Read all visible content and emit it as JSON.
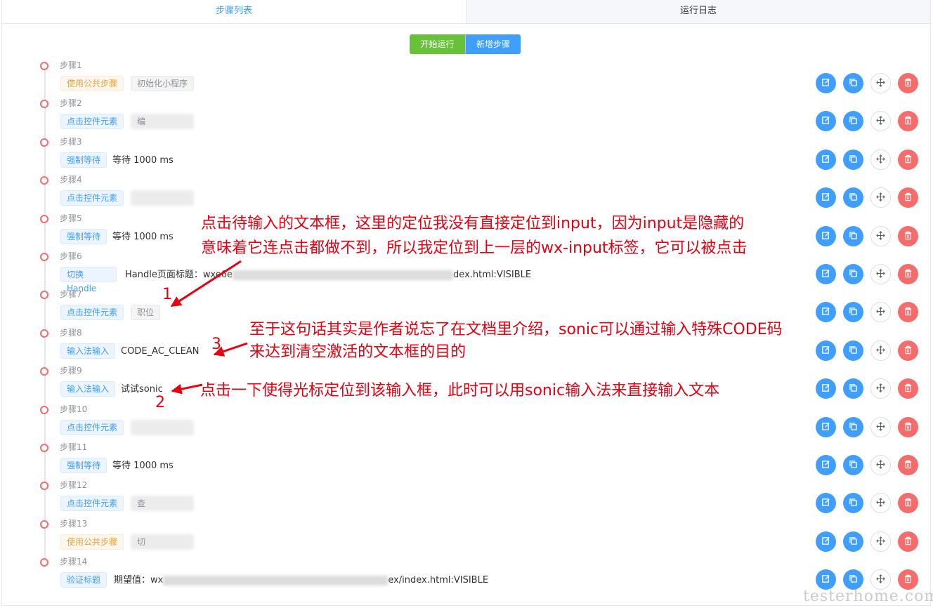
{
  "tabs": [
    "步骤列表",
    "运行日志"
  ],
  "toolbar": {
    "run": "开始运行",
    "add": "新增步骤"
  },
  "steps": [
    {
      "title": "步骤1",
      "tag": "使用公共步骤",
      "tag_type": "orange",
      "tag2": "初始化小程序"
    },
    {
      "title": "步骤2",
      "tag": "点击控件元素",
      "tag_type": "blue",
      "tag2": "编",
      "blurred": true
    },
    {
      "title": "步骤3",
      "tag": "强制等待",
      "tag_type": "blue",
      "value": "等待 1000 ms"
    },
    {
      "title": "步骤4",
      "tag": "点击控件元素",
      "tag_type": "blue",
      "tag2": "",
      "blurred": true
    },
    {
      "title": "步骤5",
      "tag": "强制等待",
      "tag_type": "blue",
      "value": "等待 1000 ms"
    },
    {
      "title": "步骤6",
      "tag": "切换Handle",
      "tag_type": "blue",
      "value_prefix": "Handle页面标题：wxe6e",
      "value_suffix": "dex.html:VISIBLE"
    },
    {
      "title": "步骤7",
      "tag": "点击控件元素",
      "tag_type": "blue",
      "tag2": "职位"
    },
    {
      "title": "步骤8",
      "tag": "输入法输入",
      "tag_type": "blue",
      "value": "CODE_AC_CLEAN"
    },
    {
      "title": "步骤9",
      "tag": "输入法输入",
      "tag_type": "blue",
      "value": "试试sonic"
    },
    {
      "title": "步骤10",
      "tag": "点击控件元素",
      "tag_type": "blue",
      "tag2": "",
      "blurred": true
    },
    {
      "title": "步骤11",
      "tag": "强制等待",
      "tag_type": "blue",
      "value": "等待 1000 ms"
    },
    {
      "title": "步骤12",
      "tag": "点击控件元素",
      "tag_type": "blue",
      "tag2": "查",
      "blurred": true
    },
    {
      "title": "步骤13",
      "tag": "使用公共步骤",
      "tag_type": "orange",
      "tag2": "切",
      "blurred": true
    },
    {
      "title": "步骤14",
      "tag": "验证标题",
      "tag_type": "blue",
      "value_prefix": "期望值：wx",
      "value_suffix": "ex/index.html:VISIBLE"
    }
  ],
  "annotations": {
    "a1_line1": "点击待输入的文本框，这里的定位我没有直接定位到input，因为input是隐藏的",
    "a1_line2": "意味着它连点击都做不到，所以我定位到上一层的wx-input标签，它可以被点击",
    "a3_line1": "至于这句话其实是作者说忘了在文档里介绍，sonic可以通过输入特殊CODE码",
    "a3_line2": "来达到清空激活的文本框的目的",
    "a2_line1": "点击一下使得光标定位到该输入框，此时可以用sonic输入法来直接输入文本",
    "n1": "1",
    "n2": "2",
    "n3": "3"
  },
  "watermark": "testerhome.com",
  "colors": {
    "primary": "#409eff",
    "success": "#67c23a",
    "danger": "#f56c6c",
    "annotation": "#e60012"
  },
  "icons": [
    "edit-icon",
    "copy-icon",
    "move-icon",
    "delete-icon"
  ]
}
